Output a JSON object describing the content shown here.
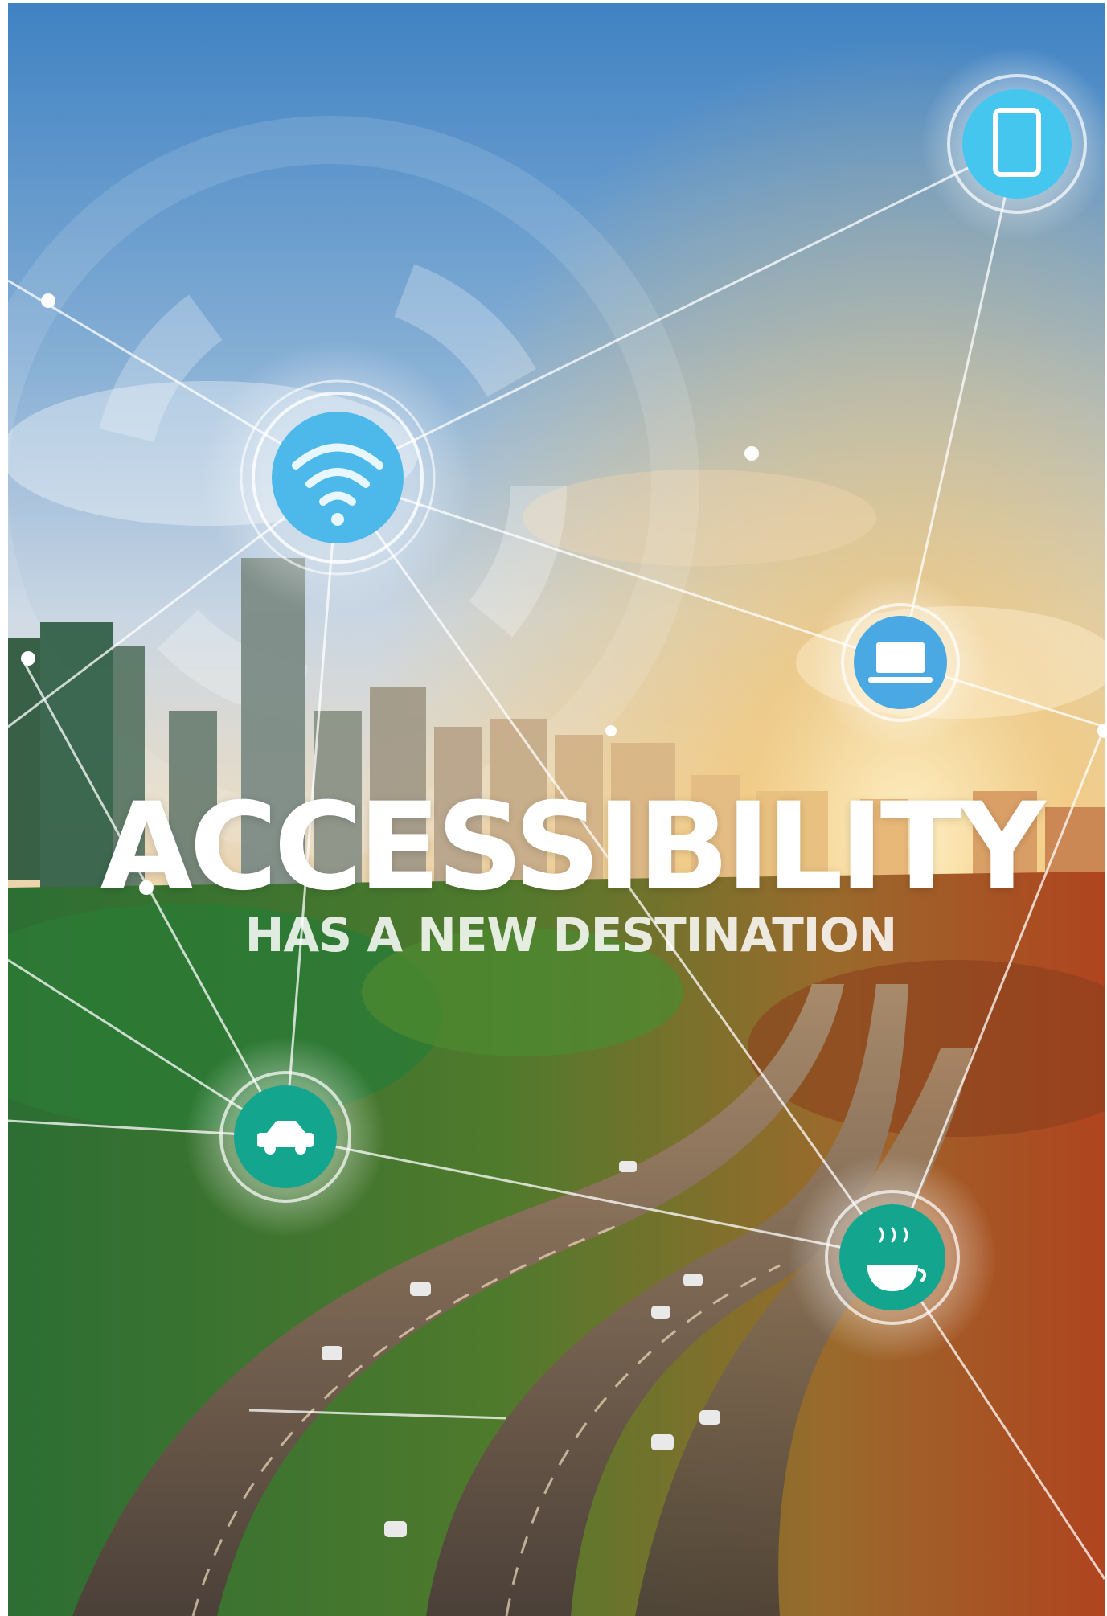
{
  "poster": {
    "headline": "ACCESSIBILITY",
    "subheadline": "HAS A NEW DESTINATION"
  },
  "network_nodes": [
    {
      "name": "wifi-icon",
      "color": "#4cb9ea"
    },
    {
      "name": "tablet-icon",
      "color": "#45c6ee"
    },
    {
      "name": "laptop-icon",
      "color": "#4aa9e3"
    },
    {
      "name": "car-icon",
      "color": "#14a58e"
    },
    {
      "name": "coffee-cup-icon",
      "color": "#14a58e"
    }
  ],
  "colors": {
    "sky_top": "#3f82c3",
    "sky_mid": "#c9d6e3",
    "sunset": "#f1b25a",
    "vegetation": "#2f6d2b",
    "road": "#6d5f52"
  }
}
